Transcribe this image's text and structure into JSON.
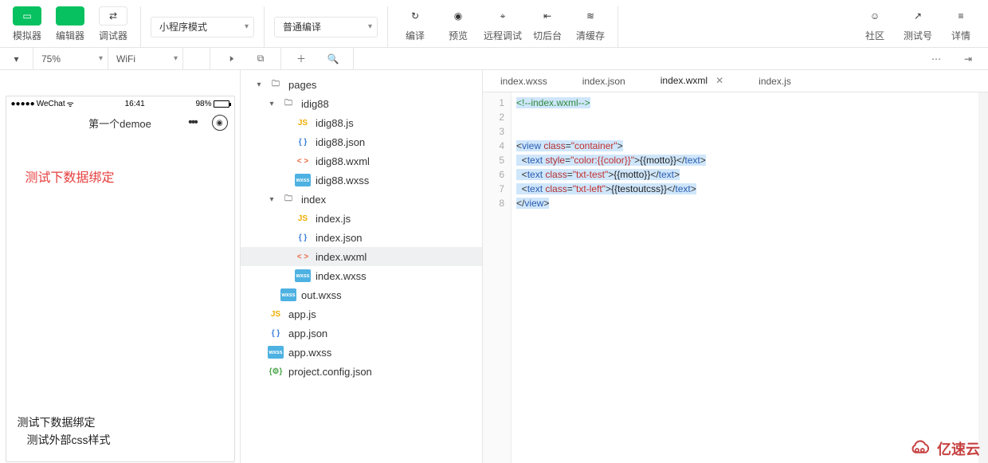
{
  "toolbar": {
    "left": [
      {
        "name": "simulator-button",
        "label": "模拟器",
        "green": true,
        "icon": "▭"
      },
      {
        "name": "editor-button",
        "label": "编辑器",
        "green": true,
        "icon": "</>"
      },
      {
        "name": "debugger-button",
        "label": "调试器",
        "green": false,
        "icon": "⇄"
      }
    ],
    "modeSelect": "小程序模式",
    "compileSelect": "普通编译",
    "actions": [
      {
        "name": "compile-button",
        "label": "编译",
        "icon": "↻"
      },
      {
        "name": "preview-button",
        "label": "预览",
        "icon": "◉"
      },
      {
        "name": "remote-debug-button",
        "label": "远程调试",
        "icon": "⌖"
      },
      {
        "name": "switch-bg-button",
        "label": "切后台",
        "icon": "⇤"
      },
      {
        "name": "clear-cache-button",
        "label": "清缓存",
        "icon": "≋"
      }
    ],
    "right": [
      {
        "name": "community-button",
        "label": "社区",
        "icon": "☺"
      },
      {
        "name": "test-account-button",
        "label": "测试号",
        "icon": "↗"
      },
      {
        "name": "details-button",
        "label": "详情",
        "icon": "≡"
      }
    ]
  },
  "secondbar": {
    "zoom": "75%",
    "network": "WiFi"
  },
  "phone": {
    "carrier": "WeChat",
    "time": "16:41",
    "batteryPct": "98%",
    "title": "第一个demoe",
    "redText": "测试下数据绑定",
    "bottom1": "测试下数据绑定",
    "bottom2": "测试外部css样式"
  },
  "tabs": [
    {
      "name": "tab-index-wxss",
      "label": "index.wxss",
      "active": false
    },
    {
      "name": "tab-index-json",
      "label": "index.json",
      "active": false
    },
    {
      "name": "tab-index-wxml",
      "label": "index.wxml",
      "active": true
    },
    {
      "name": "tab-index-js",
      "label": "index.js",
      "active": false
    }
  ],
  "tree": [
    {
      "depth": 1,
      "kind": "folder",
      "name": "pages",
      "open": true
    },
    {
      "depth": 2,
      "kind": "folder",
      "name": "idig88",
      "open": true
    },
    {
      "depth": 3,
      "kind": "js",
      "name": "idig88.js"
    },
    {
      "depth": 3,
      "kind": "json",
      "name": "idig88.json"
    },
    {
      "depth": 3,
      "kind": "wxml",
      "name": "idig88.wxml"
    },
    {
      "depth": 3,
      "kind": "wxss",
      "name": "idig88.wxss"
    },
    {
      "depth": 2,
      "kind": "folder",
      "name": "index",
      "open": true
    },
    {
      "depth": 3,
      "kind": "js",
      "name": "index.js"
    },
    {
      "depth": 3,
      "kind": "json",
      "name": "index.json"
    },
    {
      "depth": 3,
      "kind": "wxml",
      "name": "index.wxml",
      "selected": true
    },
    {
      "depth": 3,
      "kind": "wxss",
      "name": "index.wxss"
    },
    {
      "depth": 2,
      "kind": "wxss",
      "name": "out.wxss"
    },
    {
      "depth": 1,
      "kind": "js",
      "name": "app.js"
    },
    {
      "depth": 1,
      "kind": "json",
      "name": "app.json"
    },
    {
      "depth": 1,
      "kind": "wxss",
      "name": "app.wxss"
    },
    {
      "depth": 1,
      "kind": "config",
      "name": "project.config.json"
    }
  ],
  "code": {
    "lines": [
      {
        "n": 1,
        "hl": true,
        "tokens": [
          {
            "c": "tok-comment",
            "t": "<!--index.wxml-->"
          }
        ]
      },
      {
        "n": 2,
        "hl": false,
        "tokens": []
      },
      {
        "n": 3,
        "hl": false,
        "tokens": []
      },
      {
        "n": 4,
        "hl": true,
        "tokens": [
          {
            "c": "tok-punc",
            "t": "<"
          },
          {
            "c": "tok-tag",
            "t": "view"
          },
          {
            "c": "",
            "t": " "
          },
          {
            "c": "tok-attr",
            "t": "class"
          },
          {
            "c": "tok-punc",
            "t": "="
          },
          {
            "c": "tok-str",
            "t": "\"container\""
          },
          {
            "c": "tok-punc",
            "t": ">"
          }
        ]
      },
      {
        "n": 5,
        "hl": true,
        "indent": "  ",
        "tokens": [
          {
            "c": "tok-punc",
            "t": "<"
          },
          {
            "c": "tok-tag",
            "t": "text"
          },
          {
            "c": "",
            "t": " "
          },
          {
            "c": "tok-attr",
            "t": "style"
          },
          {
            "c": "tok-punc",
            "t": "="
          },
          {
            "c": "tok-str",
            "t": "\"color:{{color}}\""
          },
          {
            "c": "tok-punc",
            "t": ">"
          },
          {
            "c": "tok-text",
            "t": "{{motto}}"
          },
          {
            "c": "tok-punc",
            "t": "</"
          },
          {
            "c": "tok-tag",
            "t": "text"
          },
          {
            "c": "tok-punc",
            "t": ">"
          }
        ]
      },
      {
        "n": 6,
        "hl": true,
        "indent": "  ",
        "tokens": [
          {
            "c": "tok-punc",
            "t": "<"
          },
          {
            "c": "tok-tag",
            "t": "text"
          },
          {
            "c": "",
            "t": " "
          },
          {
            "c": "tok-attr",
            "t": "class"
          },
          {
            "c": "tok-punc",
            "t": "="
          },
          {
            "c": "tok-str",
            "t": "\"txt-test\""
          },
          {
            "c": "tok-punc",
            "t": ">"
          },
          {
            "c": "tok-text",
            "t": "{{motto}}"
          },
          {
            "c": "tok-punc",
            "t": "</"
          },
          {
            "c": "tok-tag",
            "t": "text"
          },
          {
            "c": "tok-punc",
            "t": ">"
          }
        ]
      },
      {
        "n": 7,
        "hl": true,
        "indent": "  ",
        "tokens": [
          {
            "c": "tok-punc",
            "t": "<"
          },
          {
            "c": "tok-tag",
            "t": "text"
          },
          {
            "c": "",
            "t": " "
          },
          {
            "c": "tok-attr",
            "t": "class"
          },
          {
            "c": "tok-punc",
            "t": "="
          },
          {
            "c": "tok-str",
            "t": "\"txt-left\""
          },
          {
            "c": "tok-punc",
            "t": ">"
          },
          {
            "c": "tok-text",
            "t": "{{testoutcss}}"
          },
          {
            "c": "tok-punc",
            "t": "</"
          },
          {
            "c": "tok-tag",
            "t": "text"
          },
          {
            "c": "tok-punc",
            "t": ">"
          }
        ]
      },
      {
        "n": 8,
        "hl": true,
        "tokens": [
          {
            "c": "tok-punc",
            "t": "</"
          },
          {
            "c": "tok-tag",
            "t": "view"
          },
          {
            "c": "tok-punc",
            "t": ">"
          }
        ]
      }
    ]
  },
  "watermark": "亿速云"
}
